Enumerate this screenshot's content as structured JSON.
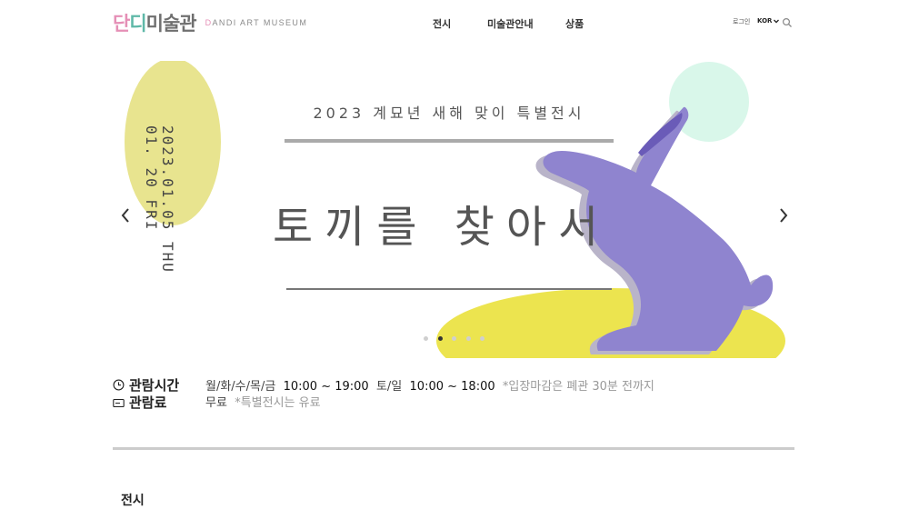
{
  "header": {
    "logo_ko": [
      "단",
      "디",
      "미술관"
    ],
    "logo_en_d": "D",
    "logo_en_rest": "ANDI ART MUSEUM",
    "nav": [
      "전시",
      "미술관안내",
      "상품"
    ],
    "login": "로그인",
    "language": "KOR"
  },
  "banner": {
    "date_line1": "2023.01.05 THU",
    "date_line2": "01. 20 FRI",
    "subtitle": "2023 계묘년 새해 맞이 특별전시",
    "title": "토끼를 찾아서",
    "slide_count": 5,
    "active_slide": 2
  },
  "info": {
    "hours_label": "관람시간",
    "weekday_days": "월/화/수/목/금",
    "weekday_hours": "10:00 ~ 19:00",
    "weekend_days": "토/일",
    "weekend_hours": "10:00 ~ 18:00",
    "hours_note": "*입장마감은 폐관 30분 전까지",
    "fee_label": "관람료",
    "fee_value": "무료",
    "fee_note": "*특별전시는 유료"
  },
  "section": {
    "title": "전시"
  },
  "colors": {
    "accent_pink": "#e58fb6",
    "accent_teal": "#5fb8a8",
    "rabbit_purple": "#8f84cf",
    "rabbit_shadow": "#b9b4c9",
    "ellipse_yellow": "#e8e48f",
    "ground_yellow": "#ece44f",
    "moon_mint": "#d9f7ea"
  }
}
